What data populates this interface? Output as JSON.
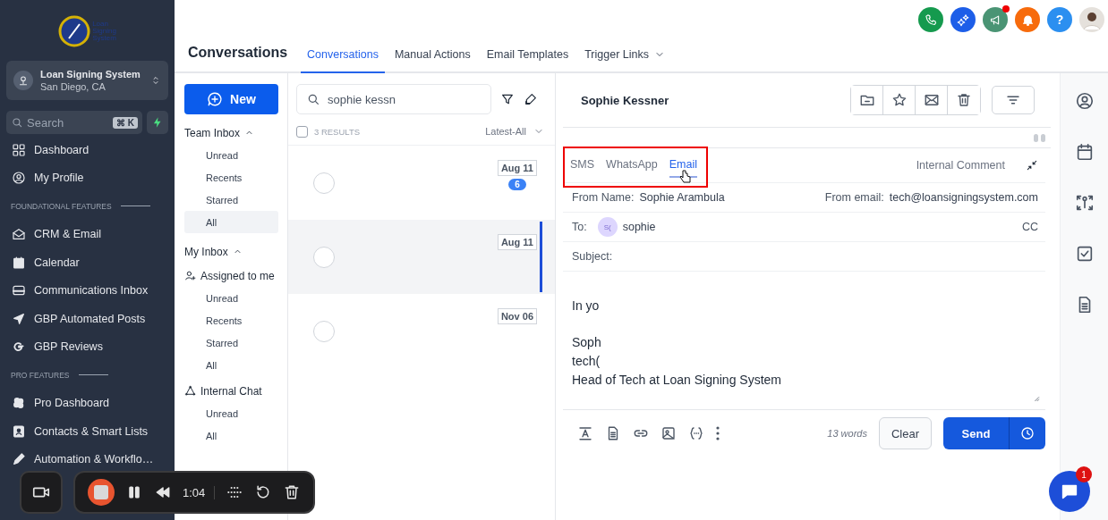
{
  "sidebar": {
    "logo": {
      "lines": [
        "Loan",
        "Signing",
        "System"
      ]
    },
    "account": {
      "name": "Loan Signing System",
      "location": "San Diego, CA"
    },
    "search": {
      "placeholder": "Search",
      "shortcut": "⌘ K"
    },
    "nav": [
      {
        "kind": "item",
        "label": "Dashboard"
      },
      {
        "kind": "item",
        "label": "My Profile"
      },
      {
        "kind": "section",
        "label": "FOUNDATIONAL FEATURES"
      },
      {
        "kind": "item",
        "label": "CRM & Email"
      },
      {
        "kind": "item",
        "label": "Calendar"
      },
      {
        "kind": "item",
        "label": "Communications Inbox"
      },
      {
        "kind": "item",
        "label": "GBP Automated Posts"
      },
      {
        "kind": "item",
        "label": "GBP Reviews"
      },
      {
        "kind": "section",
        "label": "PRO FEATURES"
      },
      {
        "kind": "item",
        "label": "Pro Dashboard"
      },
      {
        "kind": "item",
        "label": "Contacts & Smart Lists"
      },
      {
        "kind": "item",
        "label": "Automation & Workflo…"
      }
    ]
  },
  "top_actions": {
    "help_label": "?",
    "megaphone_alert": true
  },
  "page": {
    "title": "Conversations",
    "tabs": [
      {
        "label": "Conversations",
        "selected": true
      },
      {
        "label": "Manual Actions",
        "selected": false
      },
      {
        "label": "Email Templates",
        "selected": false
      },
      {
        "label": "Trigger Links",
        "selected": false
      }
    ]
  },
  "inbox_nav": {
    "new_button": "New",
    "groups": [
      {
        "kind": "collapsible",
        "label": "Team Inbox",
        "expanded": true,
        "items": [
          {
            "label": "Unread",
            "selected": false
          },
          {
            "label": "Recents",
            "selected": false
          },
          {
            "label": "Starred",
            "selected": false
          },
          {
            "label": "All",
            "selected": true
          }
        ]
      },
      {
        "kind": "collapsible",
        "label": "My Inbox",
        "expanded": true
      },
      {
        "kind": "assigned",
        "label": "Assigned to me",
        "items": [
          {
            "label": "Unread",
            "selected": false
          },
          {
            "label": "Recents",
            "selected": false
          },
          {
            "label": "Starred",
            "selected": false
          },
          {
            "label": "All",
            "selected": false
          }
        ]
      },
      {
        "kind": "chat",
        "label": "Internal Chat",
        "items": [
          {
            "label": "Unread",
            "selected": false
          },
          {
            "label": "All",
            "selected": false
          }
        ]
      }
    ]
  },
  "conversation_list": {
    "search_value": "sophie kessn",
    "select_all_checked": false,
    "results": "3 RESULTS",
    "sort": "Latest-All",
    "rows": [
      {
        "date": "Aug 11",
        "unread": "6",
        "selected": false
      },
      {
        "date": "Aug 11",
        "selected": true
      },
      {
        "date": "Nov 06",
        "selected": false
      }
    ]
  },
  "conversation": {
    "contact_name": "Sophie Kessner",
    "channel_tabs": [
      {
        "label": "SMS",
        "selected": false
      },
      {
        "label": "WhatsApp",
        "selected": false
      },
      {
        "label": "Email",
        "selected": true
      }
    ],
    "internal_comment": "Internal Comment",
    "from_name_label": "From Name:",
    "from_name": "Sophie Arambula",
    "from_email_label": "From email:",
    "from_email": "tech@loansigningsystem.com",
    "to_label": "To:",
    "recipient": {
      "initials": "S(",
      "name": "sophie"
    },
    "cc": "CC",
    "subject_label": "Subject:",
    "body": [
      [
        "In yo"
      ],
      [
        "Soph",
        "tech(",
        "Head of Tech at Loan Signing System"
      ]
    ],
    "word_count": "13 words",
    "clear_button": "Clear",
    "send_button": "Send"
  },
  "recorder": {
    "time": "1:04"
  },
  "chat_widget": {
    "badge": "1"
  }
}
